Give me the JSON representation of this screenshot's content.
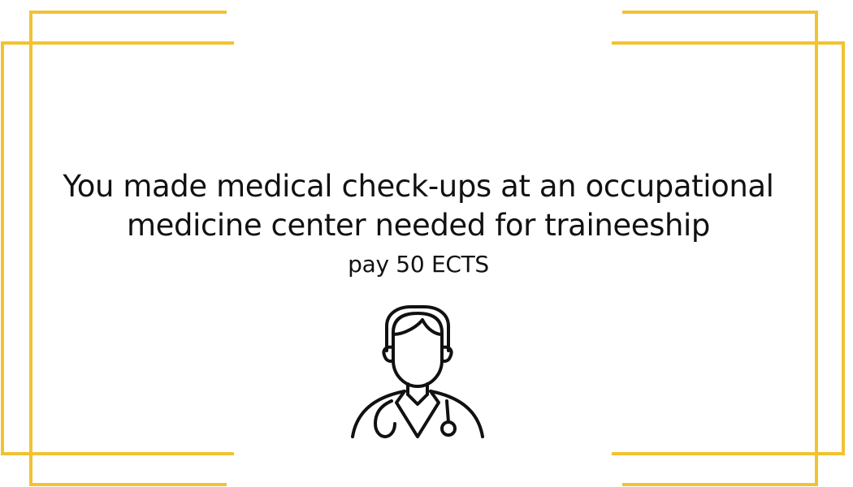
{
  "card": {
    "title": "You made medical check-ups at an occupational medicine center needed for traineeship",
    "subtitle": "pay 50 ECTS",
    "icon": "doctor-icon"
  },
  "colors": {
    "frame": "#F1C232",
    "text": "#111111",
    "background": "#FFFFFF"
  }
}
